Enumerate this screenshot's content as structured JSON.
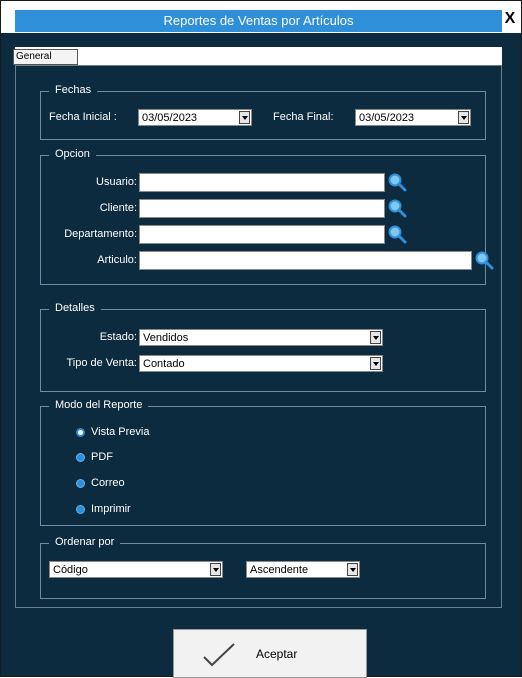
{
  "window": {
    "title": "Reportes de Ventas por Artículos",
    "close": "X"
  },
  "tabs": [
    "General"
  ],
  "fechas": {
    "legend": "Fechas",
    "inicial_label": "Fecha Inicial :",
    "inicial_value": "03/05/2023",
    "final_label": "Fecha Final:",
    "final_value": "03/05/2023"
  },
  "opcion": {
    "legend": "Opcion",
    "usuario_label": "Usuario:",
    "cliente_label": "Cliente:",
    "departamento_label": "Departamento:",
    "articulo_label": "Articulo:"
  },
  "detalles": {
    "legend": "Detalles",
    "estado_label": "Estado:",
    "estado_value": "Vendidos",
    "tipo_label": "Tipo de Venta:",
    "tipo_value": "Contado"
  },
  "modo": {
    "legend": "Modo del  Reporte",
    "options": [
      "Vista Previa",
      "PDF",
      "Correo",
      "Imprimir"
    ],
    "selected": "Vista Previa"
  },
  "ordenar": {
    "legend": "Ordenar por",
    "campo_value": "Código",
    "orden_value": "Ascendente"
  },
  "accept_label": "Aceptar",
  "colors": {
    "background": "#0d2b3e",
    "title": "#2f8fd8",
    "radio": "#2f8fd8"
  },
  "icons": [
    "close-icon",
    "search-icon",
    "dropdown-arrow-icon",
    "checkmark-icon"
  ]
}
